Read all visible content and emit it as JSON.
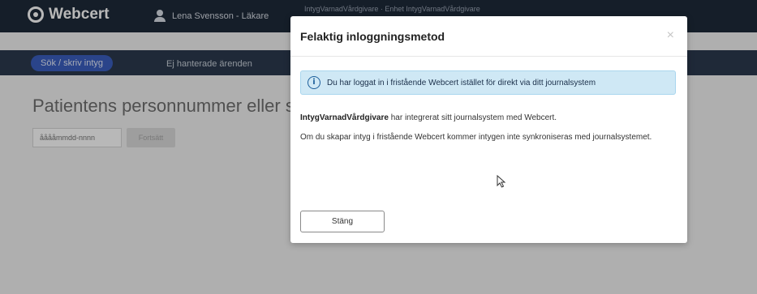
{
  "header": {
    "app_name": "Webcert",
    "user": "Lena Svensson - Läkare",
    "unit": "IntygVarnadVårdgivare · Enhet IntygVarnadVårdgivare"
  },
  "nav": {
    "search_label": "Sök / skriv intyg",
    "unhandled_label": "Ej hanterade ärenden"
  },
  "main": {
    "title": "Patientens personnummer eller samordningsnummer",
    "pnr_placeholder": "ååååmmdd-nnnn",
    "continue_label": "Fortsätt"
  },
  "modal": {
    "title": "Felaktig inloggningsmetod",
    "close_icon": "×",
    "info_icon": "i",
    "info_text": "Du har loggat in i fristående Webcert istället för direkt via ditt journalsystem",
    "care_provider": "IntygVarnadVårdgivare",
    "integration_text": "har integrerat sitt journalsystem med Webcert.",
    "sync_text": "Om du skapar intyg i fristående Webcert kommer intygen inte synkroniseras med journalsystemet.",
    "close_button": "Stäng"
  }
}
